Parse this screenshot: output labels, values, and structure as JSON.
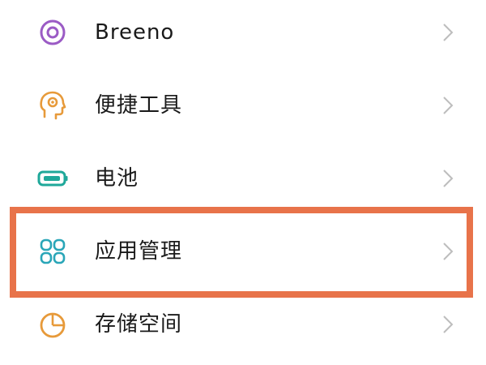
{
  "settings_list": {
    "items": [
      {
        "label": "Breeno",
        "icon": "breeno-circle-icon",
        "icon_color": "#9B5BC5"
      },
      {
        "label": "便捷工具",
        "icon": "head-gear-icon",
        "icon_color": "#E79A3A"
      },
      {
        "label": "电池",
        "icon": "battery-icon",
        "icon_color": "#1FA89A"
      },
      {
        "label": "应用管理",
        "icon": "app-grid-icon",
        "icon_color": "#2AA6B8"
      },
      {
        "label": "存储空间",
        "icon": "pie-chart-icon",
        "icon_color": "#E79A3A"
      }
    ],
    "highlighted_item": "应用管理",
    "highlight_color": "#E8734A",
    "chevron_color": "#BDBDBD"
  }
}
